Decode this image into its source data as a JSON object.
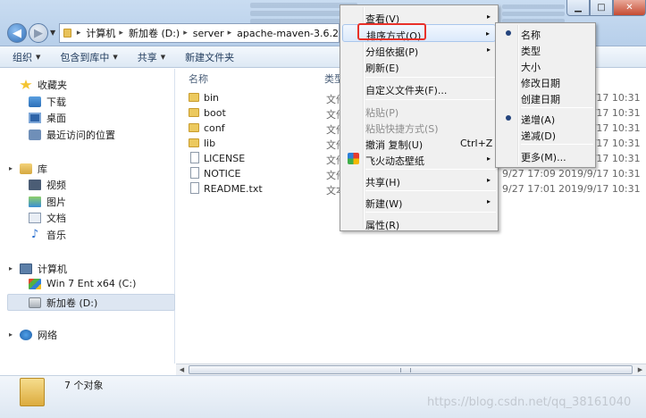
{
  "window": {
    "controls": {
      "minimize": "▁",
      "maximize": "□",
      "close": "✕"
    }
  },
  "nav": {
    "back": "◀",
    "forward": "▶",
    "history": "▼"
  },
  "address": {
    "separator": "▸",
    "crumbs": [
      "计算机",
      "新加卷 (D:)",
      "server",
      "apache-maven-3.6.2"
    ]
  },
  "toolbar": {
    "organize": "组织",
    "include_in_library": "包含到库中",
    "share": "共享",
    "new_folder": "新建文件夹",
    "dropdown_arrow": "▼"
  },
  "sidebar": {
    "favorites": "收藏夹",
    "favorites_items": [
      "下载",
      "桌面",
      "最近访问的位置"
    ],
    "libraries": "库",
    "libraries_items": [
      "视频",
      "图片",
      "文档",
      "音乐"
    ],
    "computer": "计算机",
    "computer_items": [
      "Win 7 Ent x64 (C:)",
      "新加卷 (D:)"
    ],
    "network": "网络",
    "expand_arrow": "▸"
  },
  "columns": {
    "name": "名称",
    "type": "类型"
  },
  "files": [
    {
      "name": "bin",
      "kind": "folder",
      "type": "文件",
      "date": "2019/9/17 10:31"
    },
    {
      "name": "boot",
      "kind": "folder",
      "type": "文件",
      "date": "2019/9/17 10:31"
    },
    {
      "name": "conf",
      "kind": "folder",
      "type": "文件",
      "date": "2019/9/17 10:31"
    },
    {
      "name": "lib",
      "kind": "folder",
      "type": "文件",
      "date": "2019/9/17 10:31"
    },
    {
      "name": "LICENSE",
      "kind": "file",
      "type": "文件",
      "date": "2019/9/17 10:31"
    },
    {
      "name": "NOTICE",
      "kind": "file",
      "type": "文件",
      "modified_partial": "9/27 17:09",
      "date": "2019/9/17 10:31"
    },
    {
      "name": "README.txt",
      "kind": "file",
      "type": "文本",
      "modified_partial": "9/27 17:01",
      "date": "2019/9/17 10:31"
    }
  ],
  "details": {
    "summary": "7 个对象"
  },
  "watermark": "https://blog.csdn.net/qq_38161040",
  "context_menu": {
    "view": "查看(V)",
    "sort_by": "排序方式(O)",
    "group_by": "分组依据(P)",
    "refresh": "刷新(E)",
    "customize_folder": "自定义文件夹(F)...",
    "paste": "粘贴(P)",
    "paste_shortcut": "粘贴快捷方式(S)",
    "undo_copy": "撤消 复制(U)",
    "undo_shortcut": "Ctrl+Z",
    "flyfire_wallpaper": "飞火动态壁纸",
    "share": "共享(H)",
    "new": "新建(W)",
    "properties": "属性(R)",
    "submenu_arrow": "▸"
  },
  "sort_submenu": {
    "name": "名称",
    "type": "类型",
    "size": "大小",
    "date_modified": "修改日期",
    "date_created": "创建日期",
    "ascending": "递增(A)",
    "descending": "递减(D)",
    "more": "更多(M)...",
    "selected_field": "名称",
    "selected_order": "递增(A)"
  },
  "colors": {
    "annotation": "#e8312a",
    "accent": "#24447d"
  }
}
